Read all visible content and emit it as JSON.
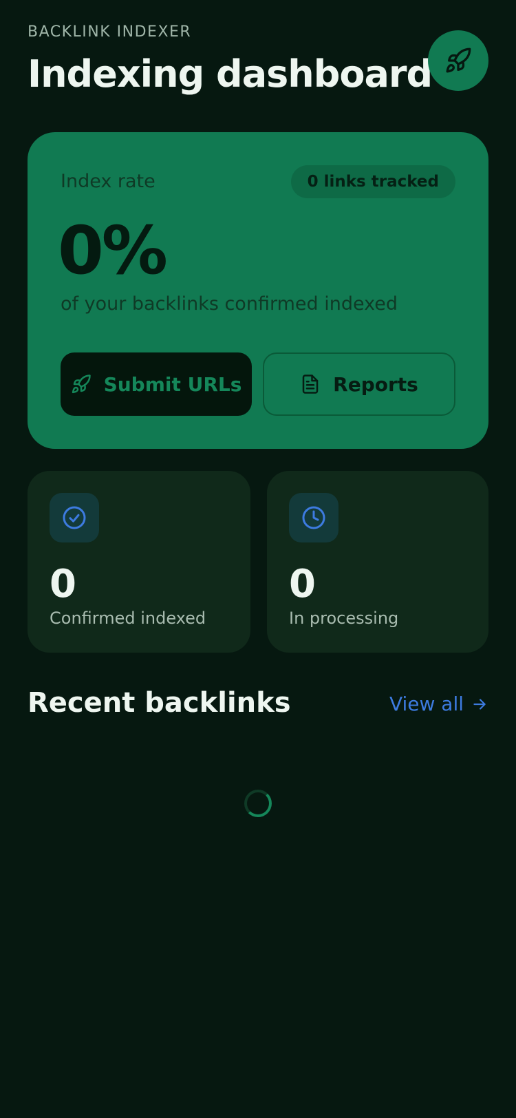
{
  "header": {
    "eyebrow": "BACKLINK INDEXER",
    "title": "Indexing dashboard",
    "action_icon": "rocket-icon"
  },
  "hero": {
    "label": "Index rate",
    "badge": "0 links tracked",
    "value": "0%",
    "subtitle": "of your backlinks confirmed indexed",
    "primary_button": {
      "label": "Submit URLs",
      "icon": "rocket-icon"
    },
    "secondary_button": {
      "label": "Reports",
      "icon": "document-icon"
    }
  },
  "stats": [
    {
      "value": "0",
      "label": "Confirmed indexed",
      "icon": "check-circle-icon"
    },
    {
      "value": "0",
      "label": "In processing",
      "icon": "clock-icon"
    }
  ],
  "recent": {
    "title": "Recent backlinks",
    "view_all": "View all",
    "view_all_icon": "arrow-right-icon",
    "loading_icon": "spinner-icon"
  },
  "colors": {
    "background": "#061810",
    "accent_green": "#117a52",
    "link_blue": "#3d7be0",
    "card": "#10291a"
  }
}
